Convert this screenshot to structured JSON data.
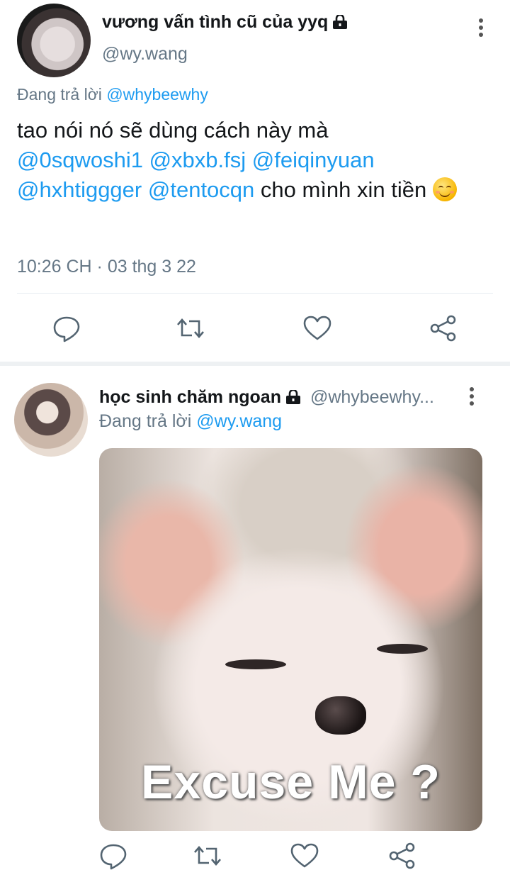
{
  "tweet1": {
    "display_name": "vương vấn tình cũ của yyq",
    "handle": "@wy.wang",
    "replying_label": "Đang trả lời",
    "replying_to": "@whybeewhy",
    "text_intro": "tao nói nó sẽ dùng cách này mà",
    "mentions": [
      "@0sqwoshi1",
      "@xbxb.fsj",
      "@feiqinyuan",
      "@hxhtiggger",
      "@tentocqn"
    ],
    "text_outro": "cho mình xin tiền",
    "timestamp": "10:26 CH · 03 thg 3 22"
  },
  "tweet2": {
    "display_name": "học sinh chăm ngoan",
    "handle": "@whybeewhy...",
    "replying_label": "Đang trả lời",
    "replying_to": "@wy.wang",
    "media_caption": "Excuse Me ?"
  },
  "icons": {
    "reply": "speech-bubble-icon",
    "retweet": "retweet-arrows-icon",
    "like": "heart-icon",
    "share": "share-nodes-icon",
    "protected": "lock-icon",
    "more": "vertical-dots-icon"
  },
  "colors": {
    "link": "#1d9bf0",
    "muted": "#657786",
    "icon": "#536471"
  }
}
